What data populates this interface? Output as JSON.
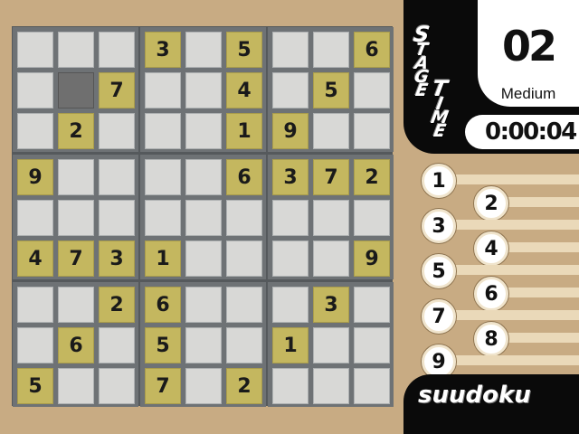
{
  "board": {
    "rows": [
      [
        "",
        "",
        "",
        "3",
        "",
        "5",
        "",
        "",
        "6"
      ],
      [
        "",
        "",
        "7",
        "",
        "",
        "4",
        "",
        "5",
        ""
      ],
      [
        "",
        "2",
        "",
        "",
        "",
        "1",
        "9",
        "",
        ""
      ],
      [
        "9",
        "",
        "",
        "",
        "",
        "6",
        "3",
        "7",
        "2"
      ],
      [
        "",
        "",
        "",
        "",
        "",
        "",
        "",
        "",
        ""
      ],
      [
        "4",
        "7",
        "3",
        "1",
        "",
        "",
        "",
        "",
        "9"
      ],
      [
        "",
        "",
        "2",
        "6",
        "",
        "",
        "",
        "3",
        ""
      ],
      [
        "",
        "6",
        "",
        "5",
        "",
        "",
        "1",
        "",
        ""
      ],
      [
        "5",
        "",
        "",
        "7",
        "",
        "2",
        "",
        "",
        ""
      ]
    ],
    "selected": [
      1,
      1
    ],
    "colors": {
      "given": "#c4b75f",
      "empty": "#d8d8d6",
      "selected": "#6f6f6f"
    }
  },
  "header": {
    "stage_label": "STAGE",
    "time_label": "TIME",
    "stage_number": "02",
    "difficulty": "Medium",
    "time": "0:00:04"
  },
  "number_buttons": [
    "1",
    "2",
    "3",
    "4",
    "5",
    "6",
    "7",
    "8",
    "9"
  ],
  "footer": {
    "brand": "suudoku"
  }
}
